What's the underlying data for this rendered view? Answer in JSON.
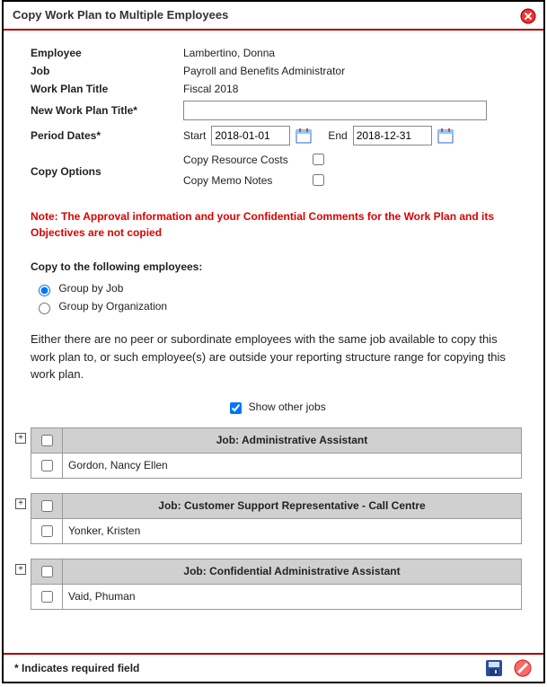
{
  "dialog": {
    "title": "Copy Work Plan to Multiple Employees"
  },
  "fields": {
    "employee_label": "Employee",
    "employee_value": "Lambertino, Donna",
    "job_label": "Job",
    "job_value": "Payroll and Benefits Administrator",
    "workplan_label": "Work Plan Title",
    "workplan_value": "Fiscal 2018",
    "new_title_label": "New Work Plan Title*",
    "new_title_value": "",
    "period_label": "Period Dates*",
    "period_start_label": "Start",
    "period_start_value": "2018-01-01",
    "period_end_label": "End",
    "period_end_value": "2018-12-31",
    "copy_options_label": "Copy Options",
    "copy_resource_label": "Copy Resource Costs",
    "copy_resource_checked": false,
    "copy_memo_label": "Copy Memo Notes",
    "copy_memo_checked": false
  },
  "note": "Note: The Approval information and your Confidential Comments for the Work Plan and its Objectives are not copied",
  "copy_to": {
    "heading": "Copy to the following employees:",
    "group_job_label": "Group by Job",
    "group_job_selected": true,
    "group_org_label": "Group by Organization",
    "group_org_selected": false
  },
  "info_message": "Either there are no peer or subordinate employees with the same job available to copy this work plan to, or such employee(s) are outside your reporting structure range for copying this work plan.",
  "show_other": {
    "label": "Show other jobs",
    "checked": true
  },
  "job_groups": [
    {
      "header": "Job: Administrative Assistant",
      "employees": [
        "Gordon, Nancy Ellen"
      ]
    },
    {
      "header": "Job: Customer Support Representative - Call Centre",
      "employees": [
        "Yonker, Kristen"
      ]
    },
    {
      "header": "Job: Confidential Administrative Assistant",
      "employees": [
        "Vaid, Phuman"
      ]
    }
  ],
  "footer": {
    "required_note": "* Indicates required field"
  }
}
